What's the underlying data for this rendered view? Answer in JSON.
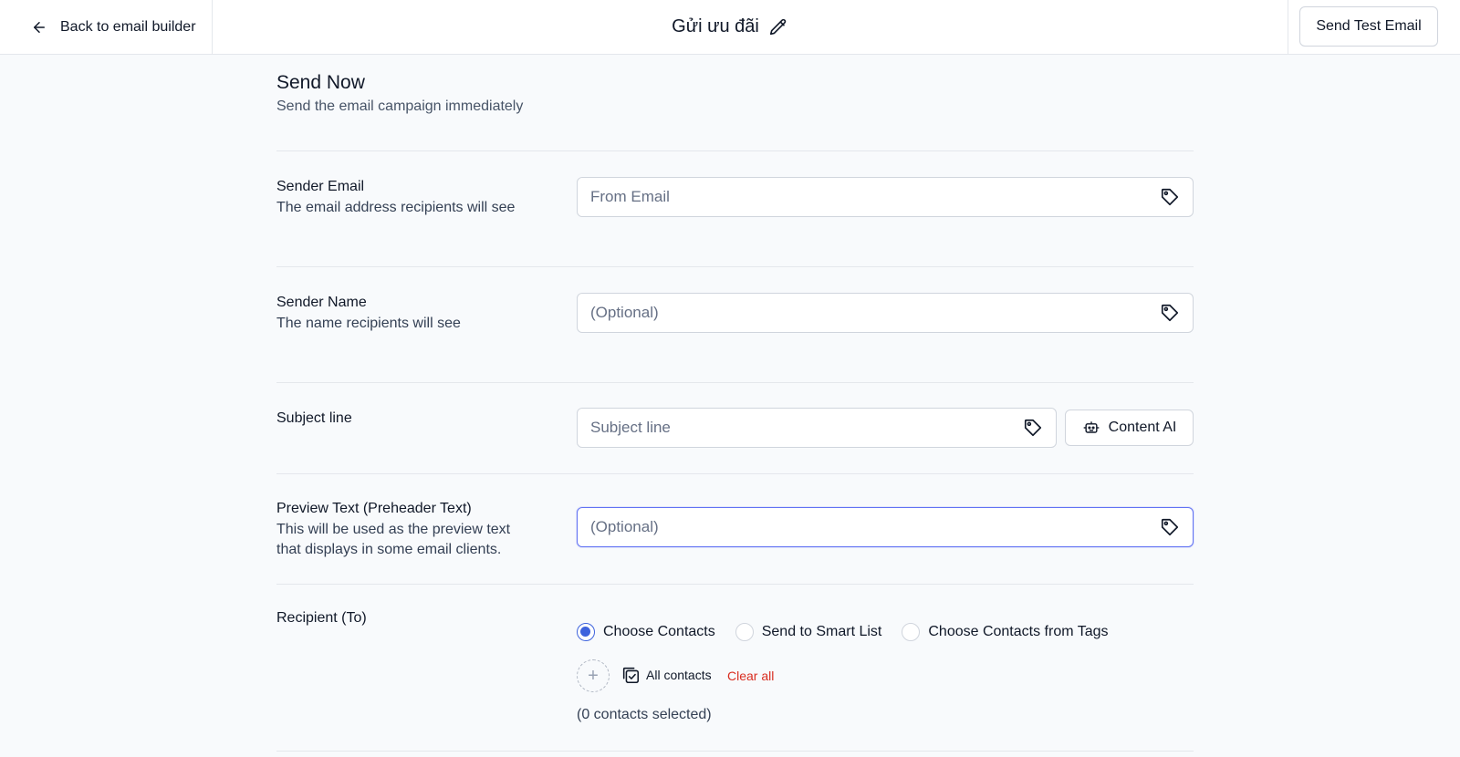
{
  "header": {
    "back_label": "Back to email builder",
    "title": "Gửi ưu đãi",
    "test_button": "Send Test Email"
  },
  "section": {
    "title": "Send Now",
    "subtitle": "Send the email campaign immediately"
  },
  "sender_email": {
    "label": "Sender Email",
    "description": "The email address recipients will see",
    "placeholder": "From Email"
  },
  "sender_name": {
    "label": "Sender Name",
    "description": "The name recipients will see",
    "placeholder": "(Optional)"
  },
  "subject": {
    "label": "Subject line",
    "placeholder": "Subject line",
    "ai_button": "Content AI"
  },
  "preview_text": {
    "label": "Preview Text (Preheader Text)",
    "description_line1": "This will be used as the preview text",
    "description_line2": "that displays in some email clients.",
    "placeholder": "(Optional)"
  },
  "recipient": {
    "label": "Recipient (To)",
    "options": [
      "Choose Contacts",
      "Send to Smart List",
      "Choose Contacts from Tags"
    ],
    "selected_option": "Choose Contacts",
    "all_contacts_label": "All contacts",
    "clear_all_label": "Clear all",
    "selected_count_text": "(0 contacts selected)"
  },
  "colors": {
    "accent": "#3e63dd",
    "danger": "#d92d20",
    "background": "#f8fafc"
  },
  "icons": {
    "back": "arrow-left-icon",
    "edit": "pencil-icon",
    "tag": "tag-icon",
    "ai": "robot-icon",
    "add": "plus-icon",
    "contacts": "checkbox-stack-icon"
  }
}
